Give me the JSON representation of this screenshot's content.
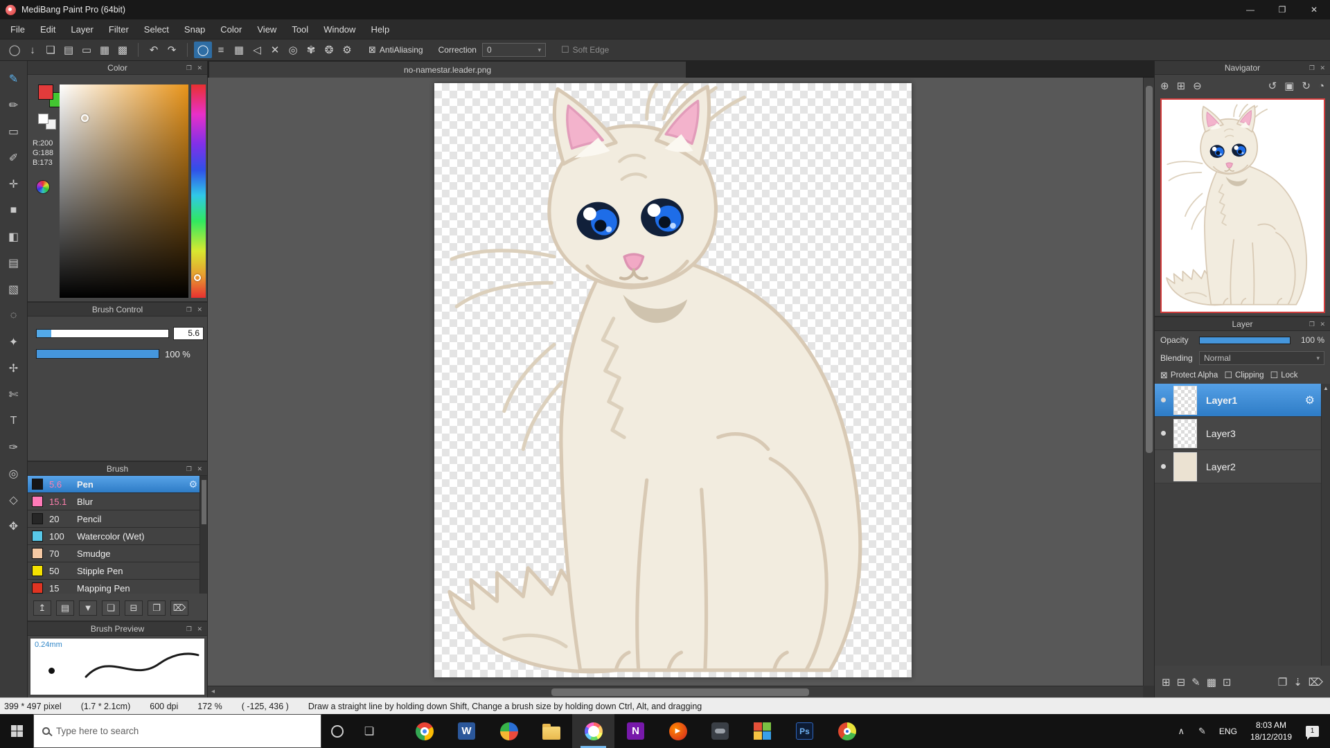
{
  "titlebar": {
    "title": "MediBang Paint Pro (64bit)",
    "minimize": "—",
    "maximize": "❐",
    "close": "✕"
  },
  "menu": {
    "items": [
      "File",
      "Edit",
      "Layer",
      "Filter",
      "Select",
      "Snap",
      "Color",
      "View",
      "Tool",
      "Window",
      "Help"
    ]
  },
  "toolbar": {
    "file_icons": [
      "◯",
      "↓",
      "❏",
      "▤",
      "▭",
      "▦",
      "▩"
    ],
    "undo": "↶",
    "redo": "↷",
    "snap_icons": [
      "◯",
      "≡",
      "▦",
      "◁",
      "✕",
      "◎",
      "✾",
      "❂",
      "⚙"
    ],
    "antialiasing_label": "AntiAliasing",
    "correction_label": "Correction",
    "correction_value": "0",
    "soft_edge_label": "Soft Edge"
  },
  "tools": {
    "glyphs": [
      "✎",
      "✏",
      "▭",
      "✐",
      "✛",
      "■",
      "◧",
      "▤",
      "▧",
      "◌",
      "✦",
      "✢",
      "✄",
      "T",
      "✑",
      "◎",
      "◇",
      "✥"
    ]
  },
  "color_panel": {
    "title": "Color",
    "r": "R:200",
    "g": "G:188",
    "b": "B:173"
  },
  "brush_control": {
    "title": "Brush Control",
    "size_value": "5.6",
    "opacity_value": "100 %"
  },
  "brush_panel": {
    "title": "Brush",
    "brushes": [
      {
        "size": "5.6",
        "name": "Pen",
        "chip": "#161616",
        "size_color": "#ff7fae"
      },
      {
        "size": "15.1",
        "name": "Blur",
        "chip": "#ff7ab8",
        "size_color": "#ff7fae"
      },
      {
        "size": "20",
        "name": "Pencil",
        "chip": "#262626",
        "size_color": "#ececec"
      },
      {
        "size": "100",
        "name": "Watercolor (Wet)",
        "chip": "#58c8e8",
        "size_color": "#ececec"
      },
      {
        "size": "70",
        "name": "Smudge",
        "chip": "#f5c9a4",
        "size_color": "#ececec"
      },
      {
        "size": "50",
        "name": "Stipple Pen",
        "chip": "#f5e200",
        "size_color": "#ececec"
      },
      {
        "size": "15",
        "name": "Mapping Pen",
        "chip": "#e03422",
        "size_color": "#ececec"
      }
    ],
    "buttons": [
      "↥",
      "▤",
      "▼",
      "❏",
      "⊟",
      "❐",
      "⌦"
    ]
  },
  "brush_preview": {
    "title": "Brush Preview",
    "size_label": "0.24mm"
  },
  "document": {
    "tab_title": "no-namestar.leader.png"
  },
  "navigator": {
    "title": "Navigator",
    "icons": [
      "⊕",
      "⊞",
      "⊖",
      "↺",
      "▣",
      "↻",
      "◔"
    ]
  },
  "layer_panel": {
    "title": "Layer",
    "opacity_label": "Opacity",
    "opacity_value": "100 %",
    "blending_label": "Blending",
    "blending_value": "Normal",
    "protect_alpha_label": "Protect Alpha",
    "clipping_label": "Clipping",
    "lock_label": "Lock",
    "layers": [
      {
        "name": "Layer1"
      },
      {
        "name": "Layer3"
      },
      {
        "name": "Layer2"
      }
    ],
    "buttons_left": [
      "⊞",
      "⊟",
      "✎",
      "▩",
      "⊡"
    ],
    "buttons_right": [
      "❐",
      "⇣",
      "⌦"
    ]
  },
  "statusbar": {
    "pixels": "399 * 497 pixel",
    "cm": "(1.7 * 2.1cm)",
    "dpi": "600 dpi",
    "zoom": "172 %",
    "coords": "( -125, 436 )",
    "hint": "Draw a straight line by holding down Shift, Change a brush size by holding down Ctrl, Alt, and dragging"
  },
  "taskbar": {
    "search_placeholder": "Type here to search",
    "apps": [
      {
        "id": "chrome"
      },
      {
        "id": "word",
        "letter": "W"
      },
      {
        "id": "photoshop-express"
      },
      {
        "id": "explorer"
      },
      {
        "id": "medibang"
      },
      {
        "id": "onenote",
        "letter": "N"
      },
      {
        "id": "media-player"
      },
      {
        "id": "dark-app"
      },
      {
        "id": "mosaic-app"
      },
      {
        "id": "photoshop",
        "letter": "Ps"
      },
      {
        "id": "browser"
      }
    ],
    "language": "ENG",
    "time": "8:03 AM",
    "date": "18/12/2019",
    "badge": "1"
  },
  "icons": {
    "panel_popout": "❐",
    "panel_close": "✕",
    "dropdown_arrow": "▾",
    "scroll_up": "▲",
    "scroll_left": "◂",
    "gear": "⚙",
    "checkbox_checked": "⊠",
    "checkbox_unchecked": "☐",
    "play": "▶",
    "task_view": "❏",
    "tray_chevron": "∧",
    "tray_pen": "✎"
  },
  "colors": {
    "accent": "#4596dc",
    "selection": "#3478c8",
    "canvas_body": "#f2ecdf"
  }
}
